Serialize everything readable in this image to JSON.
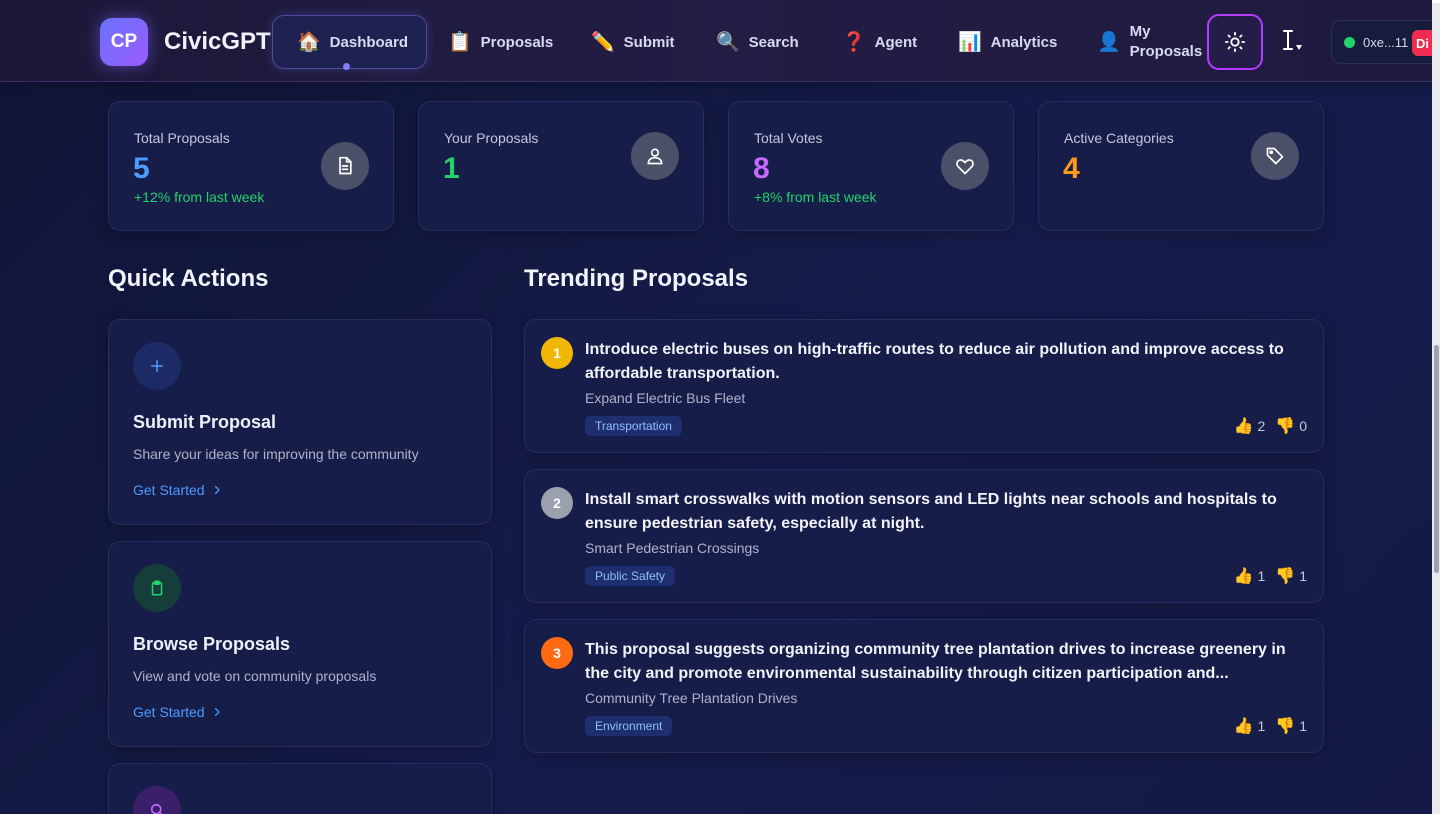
{
  "app": {
    "logo_initials": "CP",
    "name": "CivicGPT"
  },
  "nav": {
    "items": [
      {
        "icon": "house-icon",
        "emoji": "🏠",
        "label": "Dashboard",
        "active": true
      },
      {
        "icon": "clipboard-icon",
        "emoji": "📋",
        "label": "Proposals"
      },
      {
        "icon": "pencil-icon",
        "emoji": "✏️",
        "label": "Submit"
      },
      {
        "icon": "magnifier-icon",
        "emoji": "🔍",
        "label": "Search"
      },
      {
        "icon": "question-icon",
        "emoji": "❓",
        "label": "Agent"
      },
      {
        "icon": "bar-chart-icon",
        "emoji": "📊",
        "label": "Analytics"
      },
      {
        "icon": "user-icon",
        "emoji": "👤",
        "label_line1": "My",
        "label_line2": "Proposals"
      }
    ],
    "theme_toggle_icon": "sun-icon",
    "wallet": {
      "address": "0xe...11",
      "disconnect_label": "Di",
      "status_color": "#22d36b"
    }
  },
  "stats": [
    {
      "label": "Total Proposals",
      "value": "5",
      "delta": "+12% from last week",
      "color": "#4e9bff",
      "icon": "document-icon"
    },
    {
      "label": "Your Proposals",
      "value": "1",
      "delta": "",
      "color": "#22d36b",
      "icon": "user-icon"
    },
    {
      "label": "Total Votes",
      "value": "8",
      "delta": "+8% from last week",
      "color": "#c46bff",
      "icon": "heart-icon"
    },
    {
      "label": "Active Categories",
      "value": "4",
      "delta": "",
      "color": "#ff9a1a",
      "icon": "tag-icon"
    }
  ],
  "quick_actions": {
    "heading": "Quick Actions",
    "items": [
      {
        "icon": "plus-icon",
        "title": "Submit Proposal",
        "desc": "Share your ideas for improving the community",
        "link": "Get Started"
      },
      {
        "icon": "clipboard-icon",
        "title": "Browse Proposals",
        "desc": "View and vote on community proposals",
        "link": "Get Started"
      },
      {
        "icon": "search-icon",
        "title": "",
        "desc": "",
        "link": ""
      }
    ]
  },
  "trending": {
    "heading": "Trending Proposals",
    "items": [
      {
        "rank": "1",
        "rank_color": "#f2b705",
        "desc": "Introduce electric buses on high-traffic routes to reduce air pollution and improve access to affordable transportation.",
        "title": "Expand Electric Bus Fleet",
        "tag": "Transportation",
        "up": "2",
        "down": "0"
      },
      {
        "rank": "2",
        "rank_color": "#9aa0ad",
        "desc": "Install smart crosswalks with motion sensors and LED lights near schools and hospitals to ensure pedestrian safety, especially at night.",
        "title": "Smart Pedestrian Crossings",
        "tag": "Public Safety",
        "up": "1",
        "down": "1"
      },
      {
        "rank": "3",
        "rank_color": "#ff6a13",
        "desc": "This proposal suggests organizing community tree plantation drives to increase greenery in the city and promote environmental sustainability through citizen participation and...",
        "title": "Community Tree Plantation Drives",
        "tag": "Environment",
        "up": "1",
        "down": "1"
      }
    ]
  }
}
